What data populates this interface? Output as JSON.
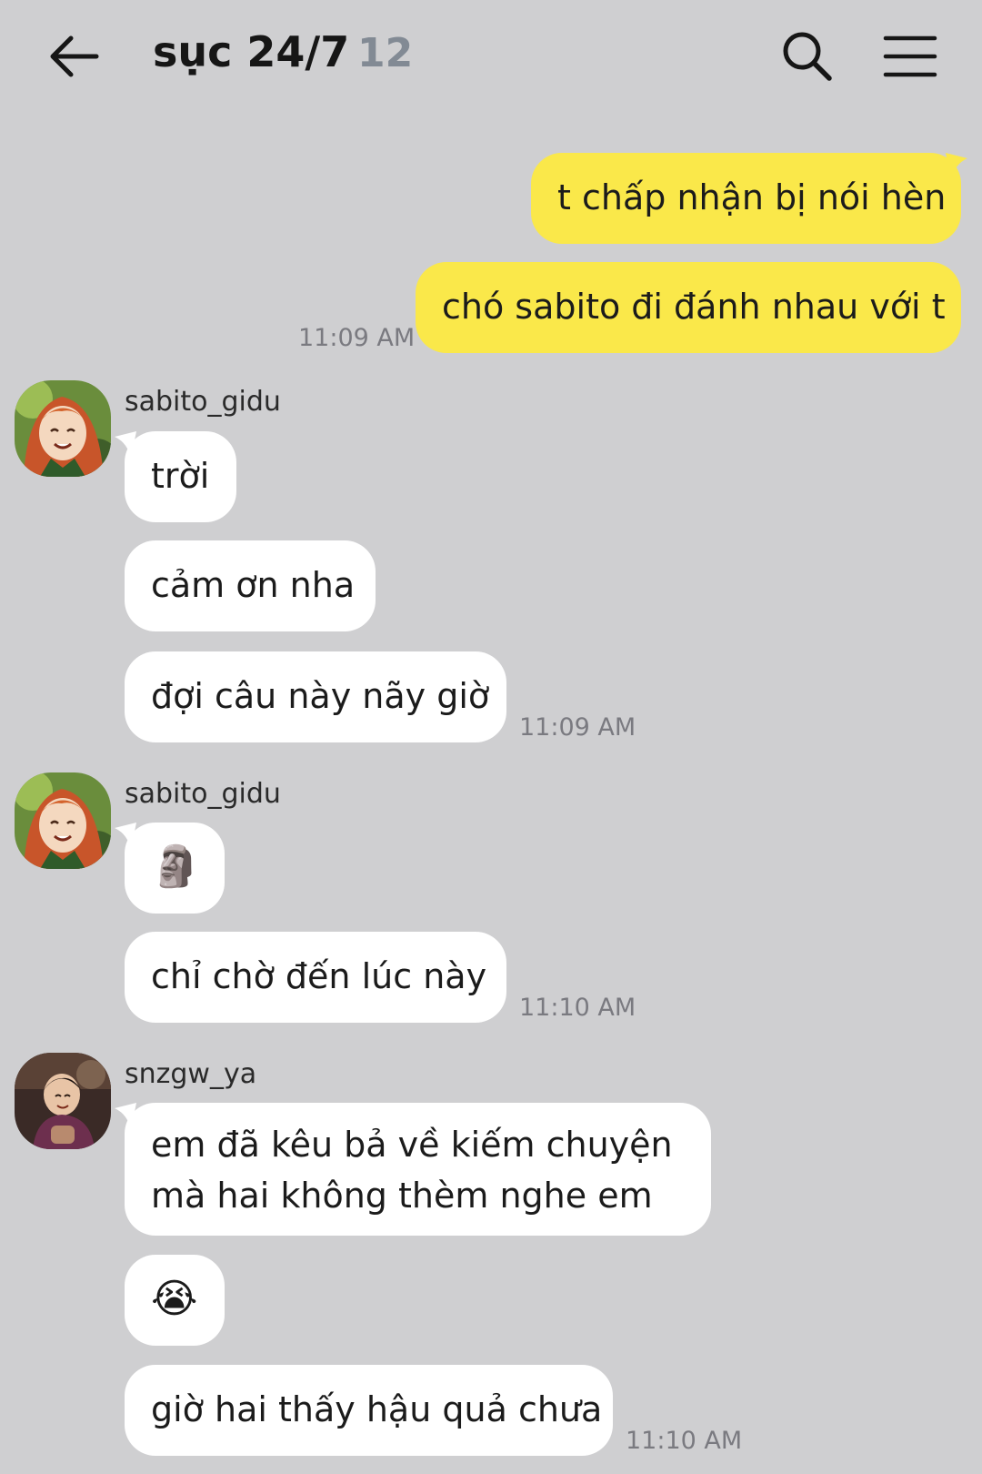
{
  "header": {
    "title": "sục 24/7",
    "member_count": "12"
  },
  "messages": {
    "m1": "t chấp nhận bị nói hèn",
    "m2": "chó sabito đi đánh nhau với t",
    "m2_time": "11:09 AM",
    "g1_sender": "sabito_gidu",
    "g1_m1": "trời",
    "g1_m2": "cảm ơn nha",
    "g1_m3": "đợi câu này nãy giờ",
    "g1_time": "11:09 AM",
    "g2_sender": "sabito_gidu",
    "g2_m1": "🗿",
    "g2_m2": "chỉ chờ đến lúc này",
    "g2_time": "11:10 AM",
    "g3_sender": "snzgw_ya",
    "g3_m1_line1": "em đã kêu bả về kiếm chuyện",
    "g3_m1_line2": "mà hai không thèm nghe em",
    "g3_m2": "😭",
    "g3_m3": "giờ hai thấy hậu quả chưa",
    "g3_time": "11:10 AM"
  },
  "colors": {
    "background": "#cfcfd1",
    "mine_bubble": "#fae84a",
    "theirs_bubble": "#ffffff",
    "timestamp": "#7a7a80"
  },
  "icons": [
    "back-arrow-icon",
    "search-icon",
    "menu-icon",
    "moai-emoji",
    "loudly-crying-emoji"
  ]
}
